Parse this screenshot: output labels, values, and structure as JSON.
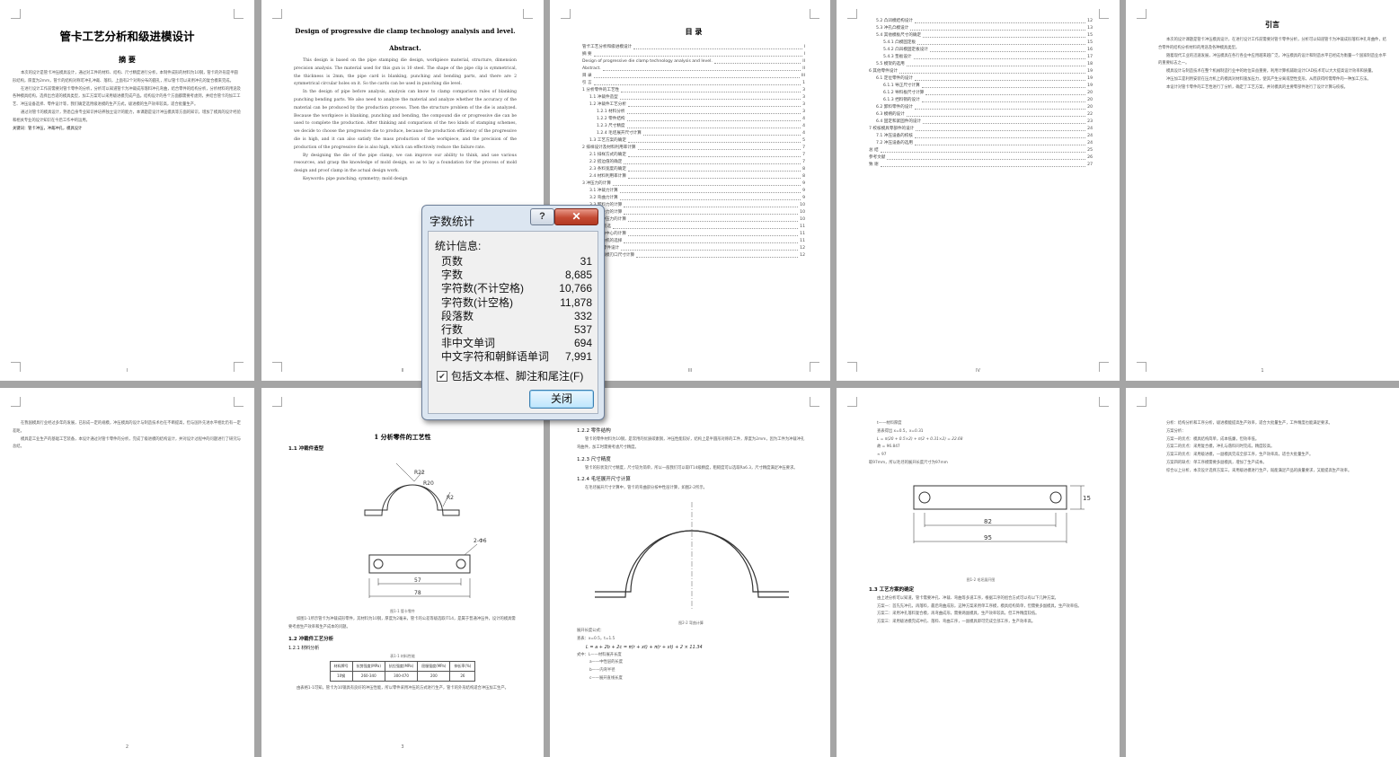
{
  "pages": {
    "p1": {
      "title": "管卡工艺分析和级进模设计",
      "abstract_heading": "摘 要",
      "paras": [
        "本次的设计是管卡冲压模具设计，通过对工件的材料、结构、尺寸精度进行分析，本制件成形的材料为10钢，管卡的外形是半圆形结构，厚度为2mm，管卡的结构对称可冲孔冲裁、落料，上面有2个对称分布的圆孔，所以管卡可以采用冲孔的复合模来完成。",
        "在进行设计工作前需要对管卡零件的分析，分析可以知道管卡为冲裁成形落料冲孔弯曲，结合零件的结构分析，分析材料的用途及各种模具结构，选择出合适的模具类型，加工方案可以采用级进模完成产品。结构设计的各个方面都需要考虑到，并结合管卡的加工工艺、冲压设备选择、零件设计等，我们确定选用级进模的生产方式，级进模的生产效率较高，适合批量生产。",
        "通过对管卡的模具设计，熟悉自身专业知识并培养独立设计的能力，本课题是设计冲压模具等方面的知识，增加了模具的设计经验和相关专业的设计知识在今后工作中的运用。"
      ],
      "keywords": "关键词：管卡冲压，冲裁冲孔，模具设计",
      "page_no": "I"
    },
    "p2": {
      "title": "Design of progressive die clamp technology analysis and level.",
      "abstract_heading": "Abstract.",
      "paras": [
        "This design is based on the pipe stamping die design, workpiece material, structure, dimension precision analysis. The material used for this gun is 10 steel. The shape of the pipe clip is symmetrical, the thickness is 2mm, the pipe card is blanking, punching and bending parts, and there are 2 symmetrical circular holes on it. So the cards can be used in punching die level.",
        "In the design of pipe before analysis, analysis can know to clamp comparison rules of blanking punching bending parts. We also need to analyze the material and analyze whether the accuracy of the material can be produced by the production process. Then the structure problem of the die is analyzed. Because the workpiece is blanking, punching and bending, the compound die or progressive die can be used to complete the production. After thinking and comparison of the two kinds of stamping schemes, we decide to choose the progressive die to produce, because the production efficiency of the progressive die is high, and it can also satisfy the mass production of the workpiece, and the precision of the production of the progressive die is also high, which can effectively reduce the failure rate.",
        "By designing the die of the pipe clamp, we can improve our ability to think, and use various resources, and grasp the knowledge of mold design, so as to lay a foundation for the process of mold design and proof clamp in the actual design work."
      ],
      "keywords": "Keywords: pipe punching; symmetry; mold design",
      "page_no": "II"
    },
    "p3": {
      "title": "目 录",
      "toc": [
        {
          "t": "管卡工艺分析和级进模设计",
          "p": "I"
        },
        {
          "t": "摘 要",
          "p": "I"
        },
        {
          "t": "Design of progressive die clamp technology analysis and level.",
          "p": "II"
        },
        {
          "t": "Abstract.",
          "p": "II"
        },
        {
          "t": "目 录",
          "p": "III"
        },
        {
          "t": "引 言",
          "p": "1"
        },
        {
          "t": "1 分析零件的工艺性",
          "p": "3"
        },
        {
          "t": "1.1 冲裁件造型",
          "p": "3"
        },
        {
          "t": "1.2 冲裁件工艺分析",
          "p": "3"
        },
        {
          "t": "1.2.1 材料分析",
          "p": "3"
        },
        {
          "t": "1.2.2 零件结构",
          "p": "4"
        },
        {
          "t": "1.2.3 尺寸精度",
          "p": "4"
        },
        {
          "t": "1.2.4 毛坯展开尺寸计算",
          "p": "4"
        },
        {
          "t": "1.3 工艺方案的确定",
          "p": "5"
        },
        {
          "t": "2 排样设计及材料利用率计算",
          "p": "7"
        },
        {
          "t": "2.1 排样方式的确定",
          "p": "7"
        },
        {
          "t": "2.2 搭边值的确定",
          "p": "7"
        },
        {
          "t": "2.3 条料宽度的确定",
          "p": "8"
        },
        {
          "t": "2.4 材料利用率计算",
          "p": "8"
        },
        {
          "t": "3 冲压力的计算",
          "p": "9"
        },
        {
          "t": "3.1 冲裁力计算",
          "p": "9"
        },
        {
          "t": "3.2 弯曲力计算",
          "p": "9"
        },
        {
          "t": "3.3 卸料力的计算",
          "p": "10"
        },
        {
          "t": "3.4 推件力的计算",
          "p": "10"
        },
        {
          "t": "3.5 总冲压力的计算",
          "p": "10"
        },
        {
          "t": "4 压力机的初选",
          "p": "11"
        },
        {
          "t": "4.1 压力中心的计算",
          "p": "11"
        },
        {
          "t": "4.2 压力机的选择",
          "p": "11"
        },
        {
          "t": "5 模具工作零件设计",
          "p": "12"
        },
        {
          "t": "5.1 凸凹模刃口尺寸计算",
          "p": "12"
        }
      ],
      "page_no": "III"
    },
    "p4": {
      "toc": [
        {
          "t": "5.2 凸凹模结构设计",
          "p": "12"
        },
        {
          "t": "5.3 冲孔凸模设计",
          "p": "13"
        },
        {
          "t": "5.4 其他模板尺寸的确定",
          "p": "15"
        },
        {
          "t": "5.4.1 凸模固定板",
          "p": "15"
        },
        {
          "t": "5.4.2 凸凹模固定板设计",
          "p": "16"
        },
        {
          "t": "5.4.3 垫板设计",
          "p": "17"
        },
        {
          "t": "5.5 模架的选用",
          "p": "18"
        },
        {
          "t": "6 其他零件设计",
          "p": "19"
        },
        {
          "t": "6.1 定位零件的设计",
          "p": "19"
        },
        {
          "t": "6.1.1 导正尺寸计算",
          "p": "19"
        },
        {
          "t": "6.1.2 导料板尺寸计算",
          "p": "20"
        },
        {
          "t": "6.1.3 挡料销的设计",
          "p": "20"
        },
        {
          "t": "6.2 卸料零件的设计",
          "p": "20"
        },
        {
          "t": "6.3 模柄的设计",
          "p": "22"
        },
        {
          "t": "6.4 固定和紧固件的设计",
          "p": "23"
        },
        {
          "t": "7 校核模具零部件的设计",
          "p": "24"
        },
        {
          "t": "7.1 冲压设备的校核",
          "p": "24"
        },
        {
          "t": "7.2 冲压设备的选用",
          "p": "24"
        },
        {
          "t": "总 结",
          "p": "25"
        },
        {
          "t": "参考文献",
          "p": "26"
        },
        {
          "t": "致 谢",
          "p": "27"
        }
      ],
      "page_no": "IV"
    },
    "p5": {
      "title": "引言",
      "paras": [
        "本次的设计课题是管卡冲压模具设计，在进行设计工作前需要对管卡零件分析，分析可以知道管卡为冲裁成形落料冲孔弯曲件，结合零件的结构分析材料的用途及各种模具类型。",
        "随着现代工业的迅速发展，冲压模具在各行各业中应用越来越广泛，冲压模具的设计和制造水平已经成为衡量一个国家制造业水平的重要标志之一。",
        "模具设计与制造技术在整个机械制造行业中的地位日益重要，利用计算机辅助设计CAD技术可以大大提高设计效率和质量。",
        "冲压加工是利用安装在压力机上的模具对材料施加压力，使其产生分离或塑性变形，从而获得所需零件的一种加工方法。",
        "本设计对管卡零件的工艺性进行了分析，确定了工艺方案，并对模具的主要零部件进行了设计计算与校核。"
      ],
      "page_no": "1"
    },
    "p6": {
      "paras": [
        "在我国模具行业经过多年的发展，已形成一定的规模，冲压模具的设计与制造技术也在不断提高，但与国外先进水平相比仍有一定差距。",
        "模具是工业生产的基础工艺装备，本设计通过对管卡零件的分析，完成了级进模的结构设计，并对设计过程中的问题进行了研究与总结。"
      ],
      "page_no": "2"
    },
    "p7": {
      "title": "1 分析零件的工艺性",
      "h1": "1.1 冲裁件造型",
      "fig_caption": "图1-1 管卡零件",
      "para": "如图1-1所示管卡为冲裁成形零件，其材料为10钢，厚度为2毫米，管卡的公差等级选取IT14，是属于普通冲压件，设计的模具需要考虑生产效率和生产成本的问题。",
      "h2": "1.2 冲裁件工艺分析",
      "h3": "1.2.1 材料分析",
      "table_caption": "表1-1 材料性能",
      "table_headers": [
        "材料牌号",
        "抗剪强度(MPa)",
        "抗拉强度(MPa)",
        "屈服强度(MPa)",
        "伸长率(%)"
      ],
      "table_row": [
        "10钢",
        "260-340",
        "300-470",
        "200",
        "26"
      ],
      "para2": "由表格1-1可知，管卡为10钢具有良好的冲压性能，所以零件采用冲压的方式进行生产，管卡的外形结构适合冲压加工生产。",
      "dims": [
        "R22",
        "R20",
        "R2",
        "57",
        "78",
        "2-Φ6"
      ],
      "page_no": "3"
    },
    "p8": {
      "h1": "1.2.2 零件结构",
      "para1": "管卡的零件材料为10钢，是常用的优质碳素钢，冲压性能较好，结构上是半圆形对称的工件，厚度为2mm，因为工件为冲裁冲孔弯曲件，加工时需要考虑尺寸精度。",
      "h2": "1.2.3 尺寸精度",
      "para2": "管卡的形状及尺寸精度，尺寸较为简单，所以一般我们可以取IT14级精度，粗糙度可以选取Ra6.3，尺寸精度满足冲压要求。",
      "h3": "1.2.4 毛坯展开尺寸计算",
      "para3": "在毛坯展开尺寸计算中，管卡的弯曲部分按中性层计算，如图2-2所示。",
      "fig_caption": "图2-2 弯曲计算",
      "calc_intro": "展开长度公式：",
      "calc1": "查表：x=0.5，t=1.5",
      "formula": "L = a + 2b + 2c = π(r + xt) + π(r + xt) + 2 × 11.34",
      "legend1": "式中：L——材料展开长度",
      "legend2": "a——中性层的长度",
      "legend3": "b——内弯半径",
      "legend4": "c——展开直线长度",
      "page_no": "4"
    },
    "p9": {
      "calc_a": "t——材料厚度",
      "calc_b": "查表得出 x=0.5，x=0.31",
      "calc_c": "L = π(20 + 0.5×2) + π(2 + 0.31×2) = 22.68",
      "calc_d": "故 = 96.847",
      "calc_e": "≈ 97",
      "calc_f": "取97mm，所以毛坯的展开长度尺寸为97mm",
      "fig_caption": "图1-2 毛坯展开图",
      "dims": [
        "82",
        "95",
        "15"
      ],
      "h": "1.3 工艺方案的确定",
      "paras": [
        "由上述分析可以知道，管卡需要冲孔、冲裁、弯曲等多道工序，根据工序的组合方式可以有以下几种方案。",
        "方案一：首先先冲孔，再落料，最后弯曲成形，这种方案采用单工序模，模具结构简单，但需要多副模具，生产效率低。",
        "方案二：采用冲孔落料复合模，再弯曲成形，需要两副模具，生产效率较高，但工件精度较低。",
        "方案三：采用级进模完成冲孔、落料、弯曲工序，一副模具即可完成全部工序，生产效率高。"
      ],
      "page_no": "5"
    },
    "p10": {
      "paras": [
        "分析：结构分析和工序分析，级进模能提高生产效率，适合大批量生产，工件精度也能满足要求。",
        "方案分析：",
        "方案一的优点：模具结构简单，成本低廉，但效率低。",
        "方案二的优点：采用复合模，冲孔与落料同时完成，精度较高。",
        "方案三的优点：采用级进模，一副模具完成全部工序，生产效率高，适合大批量生产。",
        "方案四的缺点：单工序模需要多副模具，增加了生产成本。",
        "综合以上分析，本次设计选择方案三，采用级进模进行生产，既能满足产品的质量要求，又能提高生产效率。"
      ],
      "page_no": "6"
    }
  },
  "dialog": {
    "title": "字数统计",
    "help_label": "?",
    "close_x": "✕",
    "section_label": "统计信息:",
    "stats": [
      {
        "label": "页数",
        "value": "31"
      },
      {
        "label": "字数",
        "value": "8,685"
      },
      {
        "label": "字符数(不计空格)",
        "value": "10,766"
      },
      {
        "label": "字符数(计空格)",
        "value": "11,878"
      },
      {
        "label": "段落数",
        "value": "332"
      },
      {
        "label": "行数",
        "value": "537"
      },
      {
        "label": "非中文单词",
        "value": "694"
      },
      {
        "label": "中文字符和朝鲜语单词",
        "value": "7,991"
      }
    ],
    "checkbox_label": "包括文本框、脚注和尾注(F)",
    "checkbox_checked": true,
    "close_button": "关闭"
  }
}
